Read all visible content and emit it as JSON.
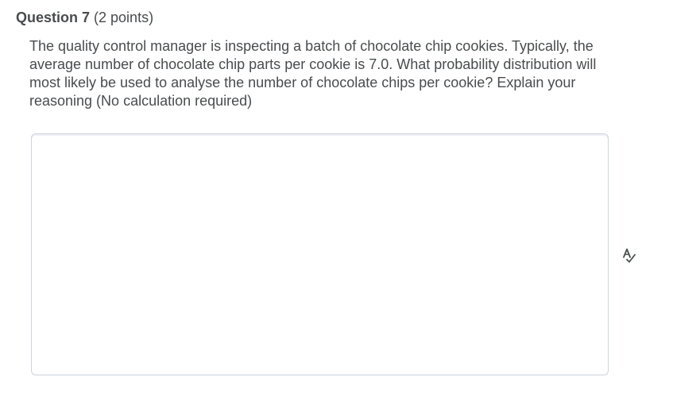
{
  "question": {
    "number_label": "Question 7",
    "points_label": "(2 points)",
    "text": "The quality control manager is inspecting a batch of chocolate chip cookies. Typically, the average number of chocolate chip parts per cookie is 7.0. What probability distribution will most likely be used to analyse the number of chocolate chips per cookie? Explain your reasoning (No calculation required)"
  },
  "answer": {
    "value": "",
    "placeholder": ""
  },
  "icons": {
    "spellcheck": "spellcheck-icon"
  }
}
